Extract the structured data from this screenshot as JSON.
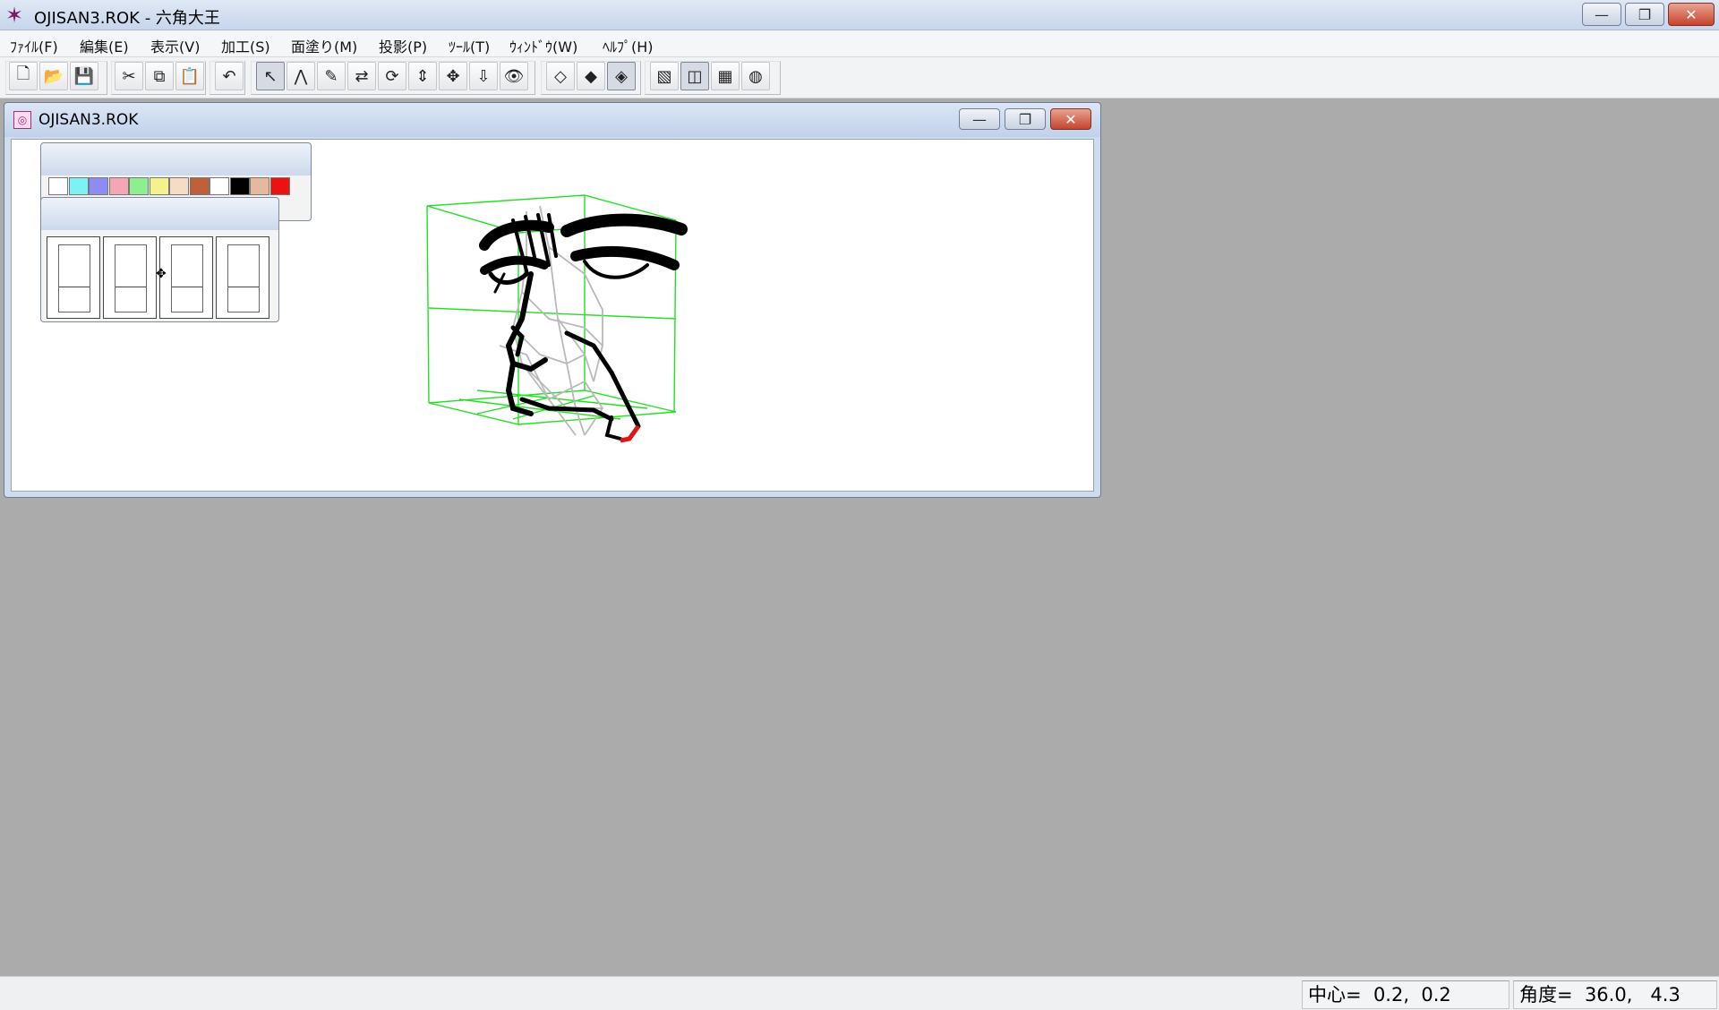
{
  "app": {
    "title": "OJISAN3.ROK - 六角大王",
    "icon": "rokkaku-daiou-app-icon"
  },
  "window_controls": {
    "minimize": "—",
    "restore": "❐",
    "close": "✕"
  },
  "menu": [
    {
      "label": "ﾌｧｲﾙ(F)"
    },
    {
      "label": "編集(E)"
    },
    {
      "label": "表示(V)"
    },
    {
      "label": "加工(S)"
    },
    {
      "label": "面塗り(M)"
    },
    {
      "label": "投影(P)"
    },
    {
      "label": "ﾂｰﾙ(T)"
    },
    {
      "label": "ｳｨﾝﾄﾞｳ(W)"
    },
    {
      "label": "ﾍﾙﾌﾟ(H)"
    }
  ],
  "toolbar": {
    "buttons": [
      {
        "name": "new-file-icon",
        "glyph": "🗋"
      },
      {
        "name": "open-folder-icon",
        "glyph": "📂"
      },
      {
        "name": "save-icon",
        "glyph": "💾"
      },
      {
        "name": "cut-icon",
        "glyph": "✂"
      },
      {
        "name": "copy-icon",
        "glyph": "⧉"
      },
      {
        "name": "paste-icon",
        "glyph": "📋"
      },
      {
        "name": "undo-icon",
        "glyph": "↶"
      },
      {
        "name": "select-arrow-icon",
        "glyph": "↖"
      },
      {
        "name": "polyline-icon",
        "glyph": "⋀"
      },
      {
        "name": "paint-icon",
        "glyph": "✎"
      },
      {
        "name": "flip-icon",
        "glyph": "⇄"
      },
      {
        "name": "rotate-icon",
        "glyph": "⟳"
      },
      {
        "name": "scale-icon",
        "glyph": "⇕"
      },
      {
        "name": "move-icon",
        "glyph": "✥"
      },
      {
        "name": "push-icon",
        "glyph": "⇩"
      },
      {
        "name": "view-eye-icon",
        "glyph": "👁"
      },
      {
        "name": "mirror-left-icon",
        "glyph": "◇"
      },
      {
        "name": "mirror-right-icon",
        "glyph": "◆"
      },
      {
        "name": "mirror-both-icon",
        "glyph": "◈"
      },
      {
        "name": "render-image-icon",
        "glyph": "▧"
      },
      {
        "name": "cube-view-icon",
        "glyph": "◫"
      },
      {
        "name": "grid-table-icon",
        "glyph": "▦"
      },
      {
        "name": "palette-icon",
        "glyph": "◍"
      }
    ]
  },
  "child_window": {
    "title": "OJISAN3.ROK",
    "icon": "document-model-icon"
  },
  "color_palette": {
    "colors": [
      "#ffffff",
      "#7ef2f2",
      "#8d8cf2",
      "#f4a6b4",
      "#8df08f",
      "#f4f28a",
      "#f6dcc4",
      "#c0603a",
      "#ffffff",
      "#000000",
      "#e6b99c",
      "#ee1111"
    ]
  },
  "statusbar": {
    "center": "中心=  0.2,  0.2",
    "angle": "角度=  36.0,   4.3"
  }
}
